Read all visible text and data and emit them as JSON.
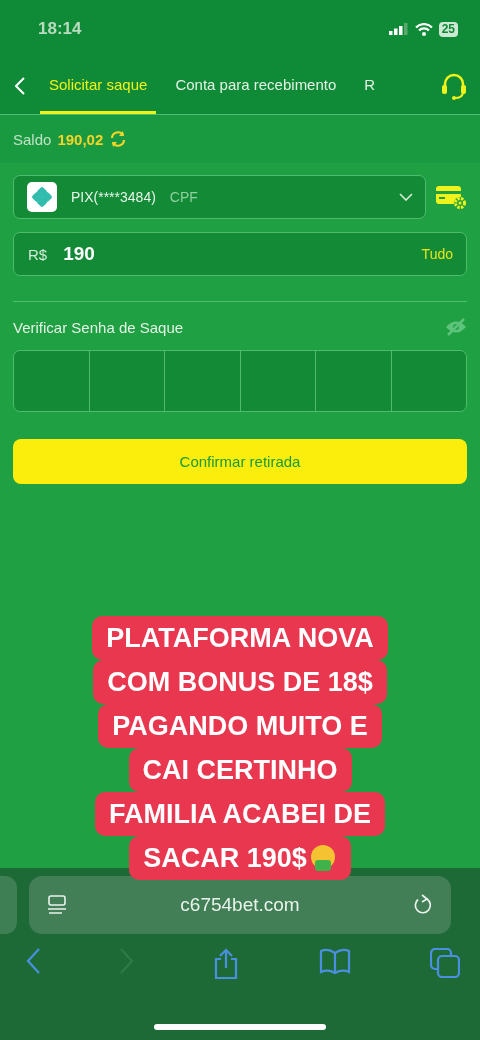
{
  "status_bar": {
    "time": "18:14",
    "battery": "25"
  },
  "tabs": [
    {
      "label": "Solicitar saque",
      "selected": true
    },
    {
      "label": "Conta para recebimento",
      "selected": false
    },
    {
      "label": "R",
      "selected": false
    }
  ],
  "balance": {
    "label": "Saldo",
    "value": "190,02"
  },
  "account_select": {
    "method": "PIX(****3484)",
    "type": "CPF"
  },
  "amount": {
    "currency": "R$",
    "value": "190",
    "all_button": "Tudo"
  },
  "password": {
    "label": "Verificar Senha de Saque",
    "visible": false,
    "cells": [
      {
        "filled": false
      },
      {
        "filled": false
      },
      {
        "filled": false
      },
      {
        "filled": false
      },
      {
        "filled": false
      },
      {
        "filled": false
      }
    ]
  },
  "confirm_button": "Confirmar retirada",
  "caption": {
    "lines": [
      "PLATAFORMA NOVA",
      "COM BONUS DE 18$",
      "PAGANDO MUITO E",
      "CAI CERTINHO",
      "FAMILIA ACABEI DE",
      "SACAR 190$"
    ],
    "emoji_end": true
  },
  "browser": {
    "url": "c6754bet.com"
  }
}
